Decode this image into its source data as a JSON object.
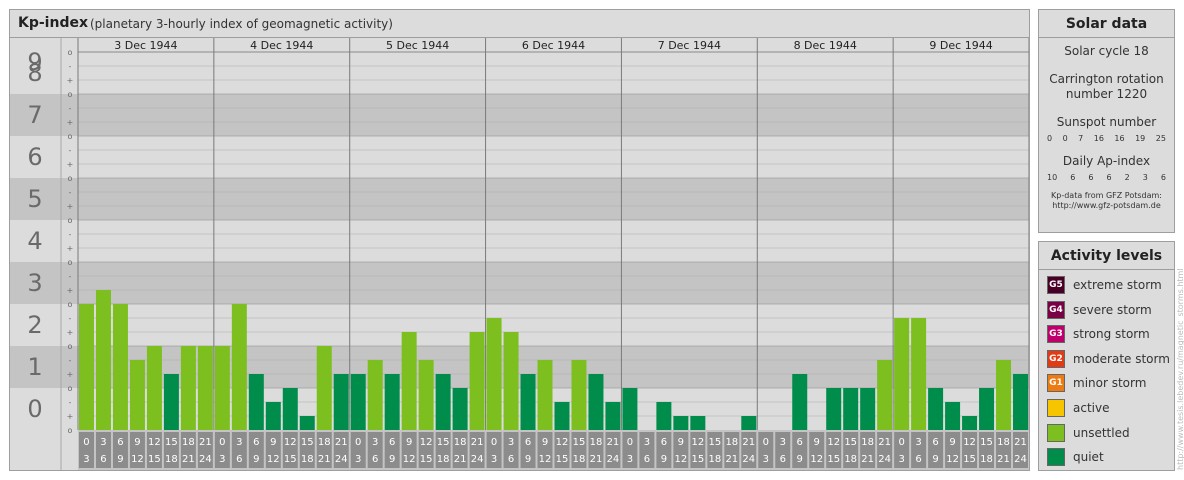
{
  "header": {
    "title": "Kp-index",
    "subtitle": "(planetary 3-hourly index of geomagnetic activity)"
  },
  "chart_data": {
    "type": "bar",
    "days": [
      "3 Dec 1944",
      "4 Dec 1944",
      "5 Dec 1944",
      "6 Dec 1944",
      "7 Dec 1944",
      "8 Dec 1944",
      "9 Dec 1944"
    ],
    "interval_start_hours": [
      "0",
      "3",
      "6",
      "9",
      "12",
      "15",
      "18",
      "21"
    ],
    "interval_end_hours": [
      "3",
      "6",
      "9",
      "12",
      "15",
      "18",
      "21",
      "24"
    ],
    "values": [
      3,
      3.333,
      3,
      1.667,
      2,
      1.333,
      2,
      2,
      2,
      3,
      1.333,
      0.667,
      1,
      0.333,
      2,
      1.333,
      1.333,
      1.667,
      1.333,
      2.333,
      1.667,
      1.333,
      1,
      2.333,
      2.667,
      2.333,
      1.333,
      1.667,
      0.667,
      1.667,
      1.333,
      0.667,
      1,
      0,
      0.667,
      0.333,
      0.333,
      0,
      0,
      0.333,
      0,
      0,
      1.333,
      0,
      1,
      1,
      1,
      1.667,
      2.667,
      2.667,
      1,
      0.667,
      0.333,
      1,
      1.667,
      1.333
    ],
    "y_major_ticks": [
      "0",
      "1",
      "2",
      "3",
      "4",
      "5",
      "6",
      "7",
      "8",
      "9"
    ],
    "y_minor_ticks": [
      "+",
      "o",
      "-"
    ],
    "ylim": [
      0,
      9
    ],
    "colors": {
      "quiet": "#008c4a",
      "unsettled": "#7cbf1e",
      "band_dark": "#c4c4c4",
      "band_light": "#dcdcdc",
      "axis_box": "#8c8c8c"
    }
  },
  "solar_data": {
    "title": "Solar data",
    "solar_cycle": "Solar cycle 18",
    "carrington_line1": "Carrington rotation",
    "carrington_line2": "number 1220",
    "sunspot_title": "Sunspot number",
    "sunspot_values": [
      "0",
      "0",
      "7",
      "16",
      "16",
      "19",
      "25"
    ],
    "ap_title": "Daily Ap-index",
    "ap_values": [
      "10",
      "6",
      "6",
      "6",
      "2",
      "3",
      "6"
    ],
    "credit_line1": "Kp-data from  GFZ Potsdam:",
    "credit_line2": "http://www.gfz-potsdam.de"
  },
  "activity_levels": {
    "title": "Activity levels",
    "items": [
      {
        "code": "G5",
        "label": "extreme storm",
        "color": "#4a0026"
      },
      {
        "code": "G4",
        "label": "severe storm",
        "color": "#7a0046"
      },
      {
        "code": "G3",
        "label": "strong storm",
        "color": "#c0006a"
      },
      {
        "code": "G2",
        "label": "moderate storm",
        "color": "#e23a14"
      },
      {
        "code": "G1",
        "label": "minor storm",
        "color": "#ee7a10"
      },
      {
        "code": "",
        "label": "active",
        "color": "#f7c400"
      },
      {
        "code": "",
        "label": "unsettled",
        "color": "#7cbf1e"
      },
      {
        "code": "",
        "label": "quiet",
        "color": "#008c4a"
      }
    ]
  },
  "watermark": "http://www.tesis.lebedev.ru/magnetic_storms.html"
}
